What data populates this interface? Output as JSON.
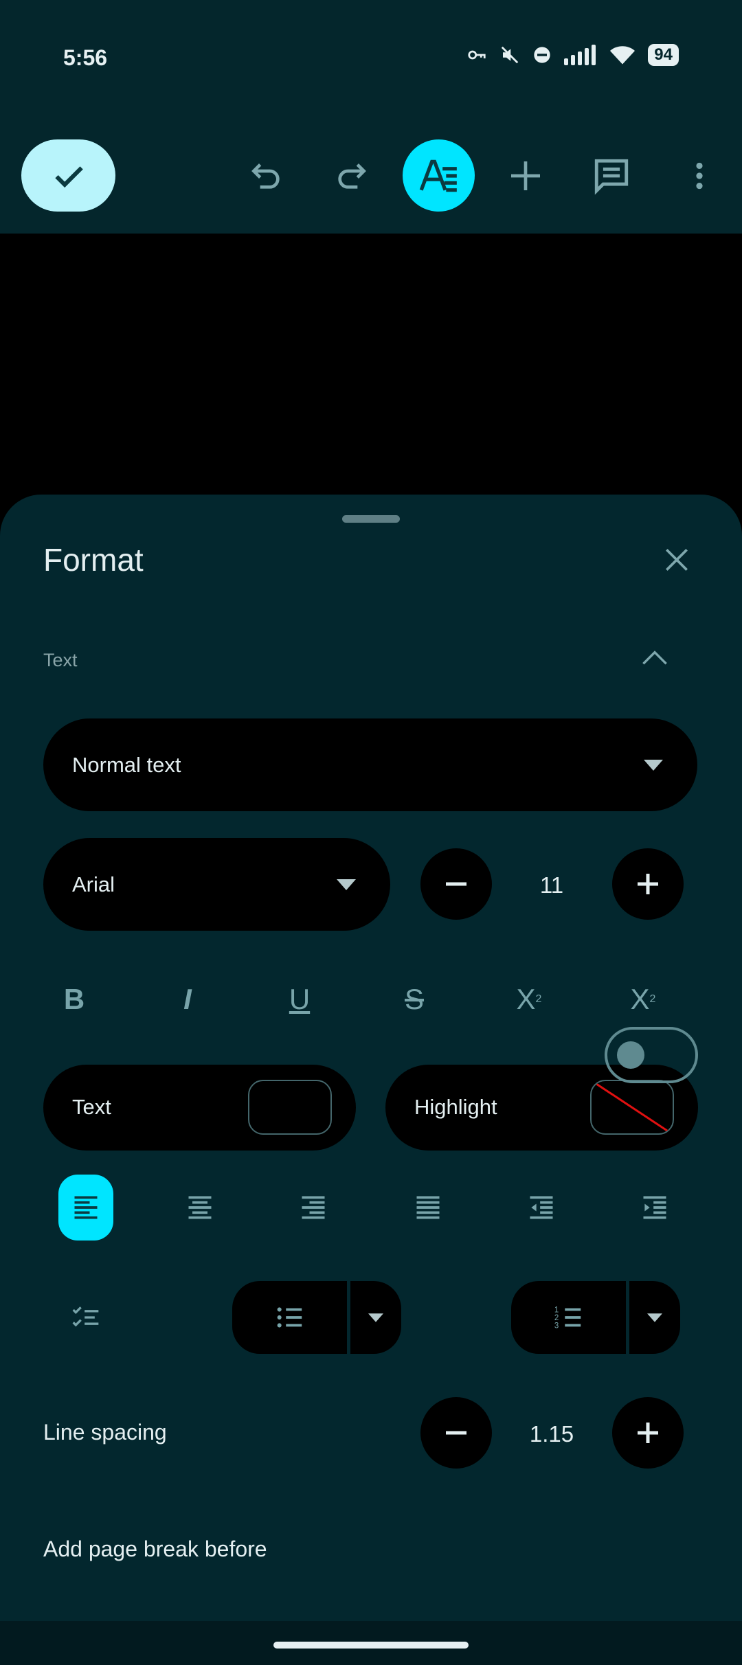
{
  "status_bar": {
    "time": "5:56",
    "battery": "94",
    "icons": [
      "vpn-key-icon",
      "mute-icon",
      "dnd-icon",
      "signal-icon",
      "wifi-icon",
      "battery-icon"
    ]
  },
  "toolbar": {
    "icons": [
      "check-icon",
      "undo-icon",
      "redo-icon",
      "text-format-icon",
      "add-icon",
      "comment-icon",
      "more-vert-icon"
    ]
  },
  "format_sheet": {
    "title": "Format",
    "text_section": {
      "label": "Text",
      "paragraph_style": "Normal text",
      "font": "Arial",
      "font_size": "11",
      "styles": [
        "B",
        "I",
        "U",
        "S",
        "X",
        "X"
      ],
      "text_color_label": "Text",
      "highlight_label": "Highlight",
      "alignment_selected": "left",
      "line_spacing_label": "Line spacing",
      "line_spacing_value": "1.15",
      "page_break_label": "Add page break before",
      "page_break_enabled": false
    }
  },
  "colors": {
    "background": "#03272e",
    "accent": "#00e5ff",
    "done_button": "#b8f4fb",
    "highlight_none_line": "#e01010"
  }
}
